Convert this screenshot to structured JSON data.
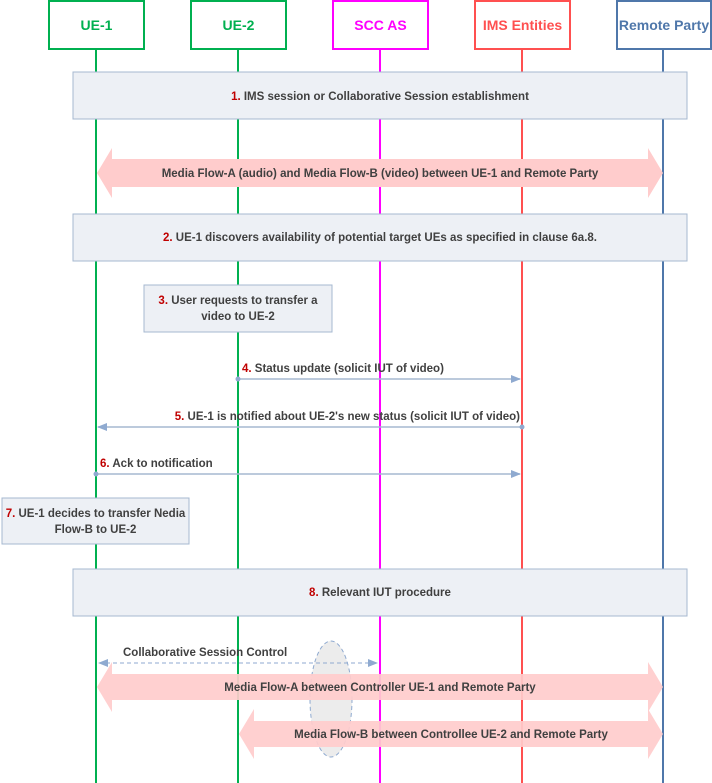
{
  "participants": [
    {
      "id": "ue1",
      "label": "UE-1",
      "color": "#00b050"
    },
    {
      "id": "ue2",
      "label": "UE-2",
      "color": "#00b050"
    },
    {
      "id": "sccas",
      "label": "SCC AS",
      "color": "#ff00ff"
    },
    {
      "id": "ims",
      "label": "IMS Entities",
      "color": "#ff5050"
    },
    {
      "id": "remote",
      "label": "Remote Party",
      "color": "#4f77aa"
    }
  ],
  "steps": {
    "s1": {
      "num": "1.",
      "text": " IMS session or Collaborative Session establishment"
    },
    "flow_ab": {
      "text": "Media Flow-A (audio) and Media Flow-B (video) between UE-1 and Remote Party"
    },
    "s2": {
      "num": "2.",
      "text": " UE-1 discovers availability of potential target UEs as specified in clause 6a.8."
    },
    "s3": {
      "num": "3.",
      "line1": " User requests to transfer a",
      "line2": "video to UE-2"
    },
    "s4": {
      "num": "4.",
      "text": " Status update (solicit IUT of video)"
    },
    "s5": {
      "num": "5.",
      "text": " UE-1 is notified about UE-2's new status (solicit IUT of video)"
    },
    "s6": {
      "num": "6.",
      "text": " Ack to notification"
    },
    "s7": {
      "num": "7.",
      "line1": " UE-1 decides to transfer Nedia",
      "line2": "Flow-B to UE-2"
    },
    "s8": {
      "num": "8.",
      "text": " Relevant IUT procedure"
    },
    "csc": {
      "text": "Collaborative Session Control"
    },
    "flow_a": {
      "text": "Media Flow-A between Controller UE-1 and Remote Party"
    },
    "flow_b": {
      "text": "Media Flow-B between Controllee UE-2 and Remote Party"
    }
  },
  "colors": {
    "box_fill": "#edf0f5",
    "box_stroke": "#a6b8d0",
    "flow_fill": "#ffcccc",
    "arrow": "#8faad0",
    "step_number": "#c00000",
    "text": "#404040"
  }
}
